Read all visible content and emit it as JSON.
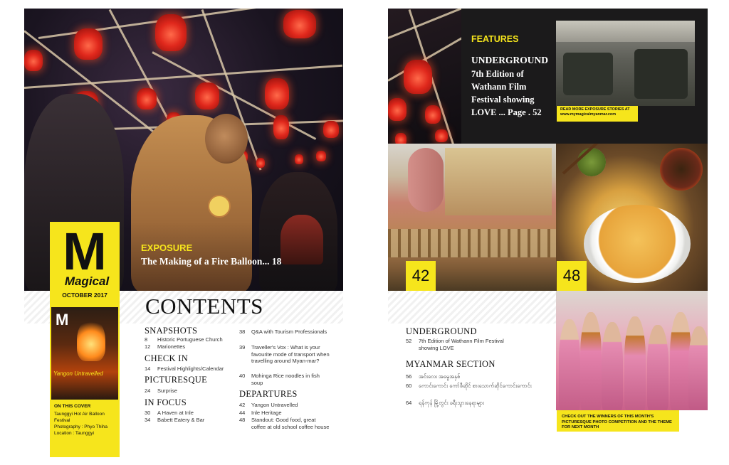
{
  "left_page": {
    "cover_logo": {
      "letter": "M",
      "word": "Magical",
      "issue": "OCTOBER 2017"
    },
    "exposure": {
      "label": "EXPOSURE",
      "title": "The Making of a Fire Balloon... 18"
    },
    "contents_heading": "CONTENTS",
    "cover_thumb": {
      "letter": "M",
      "label": "Yangon Untravelled"
    },
    "on_this_cover": {
      "title": "ON THIS COVER",
      "lines": [
        "Taunggyi Hot Air Balloon",
        "Festival",
        "Photography : Phyo Thiha",
        "Location : Taunggyi"
      ]
    },
    "sections_col1": [
      {
        "heading": "SNAPSHOTS",
        "items": [
          {
            "page": "8",
            "title": "Historic Portuguese Church"
          },
          {
            "page": "12",
            "title": "Marionettes"
          }
        ]
      },
      {
        "heading": "CHECK IN",
        "items": [
          {
            "page": "14",
            "title": "Festival Highlights/Calendar"
          }
        ]
      },
      {
        "heading": "PICTURESQUE",
        "items": [
          {
            "page": "24",
            "title": "Surprise"
          }
        ]
      },
      {
        "heading": "IN FOCUS",
        "items": [
          {
            "page": "30",
            "title": "A Haven at Inle"
          },
          {
            "page": "34",
            "title": "Babett Eatery & Bar"
          }
        ]
      }
    ],
    "col2_items": [
      {
        "page": "38",
        "title": "Q&A with Tourism Professionals"
      },
      {
        "page": "39",
        "title": "Traveller's Vox : What is your favourite mode of transport when travelling around Myan-mar?"
      },
      {
        "page": "40",
        "title": "Mohinga Rice noodles in fish soup"
      }
    ],
    "departures": {
      "heading": "DEPARTURES",
      "items": [
        {
          "page": "42",
          "title": "Yangon Untravelled"
        },
        {
          "page": "44",
          "title": "Inle Heritage"
        },
        {
          "page": "48",
          "title": "Standout: Good food, great coffee at old school coffee house"
        }
      ]
    }
  },
  "right_page": {
    "features": {
      "label": "FEATURES",
      "heading": "UNDERGROUND",
      "lines": [
        "7th Edition of",
        "Wathann Film",
        "Festival showing",
        "LOVE ... Page . 52"
      ],
      "more_stories": "READ MORE EXPOSURE STORIES AT",
      "more_stories_url": "www.mymagicalmyanmar.com"
    },
    "photo_numbers": {
      "left": "42",
      "right": "48"
    },
    "underground": {
      "heading": "UNDERGROUND",
      "page": "52",
      "title": "7th Edition of Wathann Film Festival showing LOVE"
    },
    "myanmar_section": {
      "heading": "MYANMAR SECTION",
      "items": [
        {
          "page": "56",
          "title": "အင်းလေး အမွေအနှစ်"
        },
        {
          "page": "60",
          "title": "ကောင်းကောင်း ကော်ဖီဆိုင် စားသောက်ဆိုင်ကောင်းကောင်း"
        },
        {
          "page": "64",
          "title": "ရန်ကုန် မြို့တွင်း ခရီးသွားနေရာများ"
        }
      ]
    },
    "winners_note": "CHECK OUT THE WINNERS OF THIS MONTH'S PICTURESQUE PHOTO COMPETITION AND THE THEME FOR NEXT MONTH"
  }
}
